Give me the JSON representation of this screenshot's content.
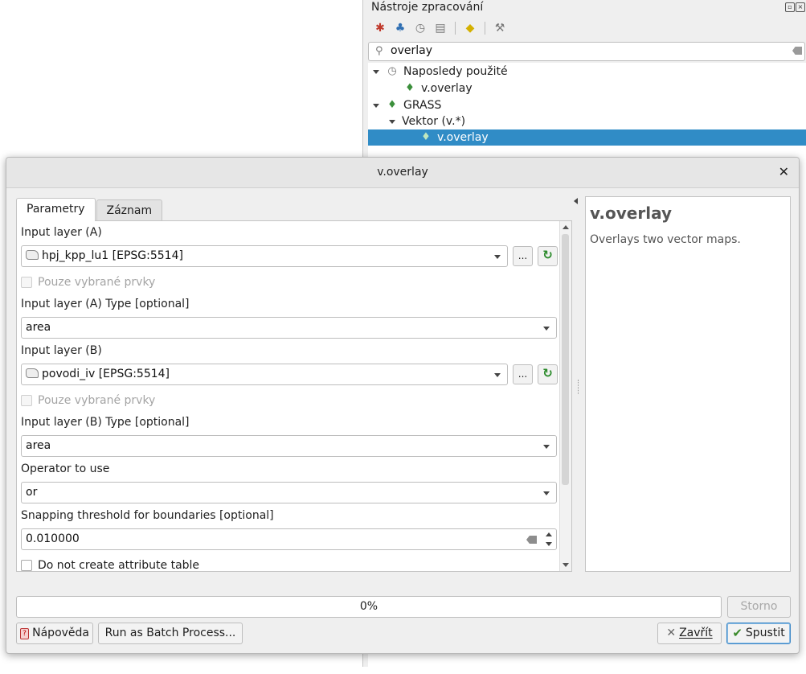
{
  "toolbox": {
    "title": "Nástroje zpracování",
    "search_value": "overlay",
    "tree": [
      {
        "label": "Naposledy použité",
        "level": 0,
        "icon": "clock-icon",
        "expanded": true
      },
      {
        "label": "v.overlay",
        "level": 1,
        "icon": "grass-icon"
      },
      {
        "label": "GRASS",
        "level": 0,
        "icon": "grass-icon",
        "expanded": true
      },
      {
        "label": "Vektor (v.*)",
        "level": 1,
        "icon": "",
        "expanded": true
      },
      {
        "label": "v.overlay",
        "level": 2,
        "icon": "grass-icon",
        "selected": true
      }
    ]
  },
  "dialog": {
    "title": "v.overlay",
    "tabs": [
      "Parametry",
      "Záznam"
    ],
    "params": {
      "input_a_label": "Input layer (A)",
      "input_a_value": "hpj_kpp_lu1 [EPSG:5514]",
      "selected_only_label": "Pouze vybrané prvky",
      "input_a_type_label": "Input layer (A) Type [optional]",
      "input_a_type_value": "area",
      "input_b_label": "Input layer (B)",
      "input_b_value": "povodi_iv [EPSG:5514]",
      "input_b_type_label": "Input layer (B) Type [optional]",
      "input_b_type_value": "area",
      "operator_label": "Operator to use",
      "operator_value": "or",
      "snap_label": "Snapping threshold for boundaries [optional]",
      "snap_value": "0.010000",
      "no_table_label": "Do not create attribute table",
      "browse_label": "..."
    },
    "help": {
      "title": "v.overlay",
      "description": "Overlays two vector maps."
    },
    "progress": {
      "text": "0%",
      "value": 0
    },
    "buttons": {
      "cancel": "Storno",
      "help": "Nápověda",
      "batch": "Run as Batch Process...",
      "close": "Zavřít",
      "run": "Spustit"
    }
  },
  "colors": {
    "selection": "#308cc6",
    "dialog_bg": "#efefef"
  }
}
